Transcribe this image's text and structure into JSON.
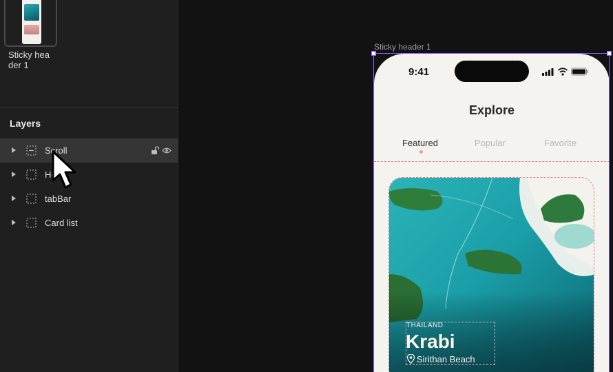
{
  "pages_panel": {
    "page_name": "Sticky hea\nder 1"
  },
  "layers_panel": {
    "title": "Layers",
    "layers": [
      {
        "name": "Scroll",
        "selected": true
      },
      {
        "name": "He",
        "selected": false
      },
      {
        "name": "tabBar",
        "selected": false
      },
      {
        "name": "Card list",
        "selected": false
      }
    ]
  },
  "canvas": {
    "frame_label": "Sticky header 1",
    "selection_color": "#8b5cf6",
    "guide_color": "#e37a86"
  },
  "phone": {
    "status_time": "9:41",
    "title": "Explore",
    "tabs": [
      {
        "label": "Featured",
        "active": true
      },
      {
        "label": "Popular",
        "active": false
      },
      {
        "label": "Favorite",
        "active": false
      }
    ],
    "card": {
      "country": "THAILAND",
      "city": "Krabi",
      "place": "Sirithan Beach"
    }
  }
}
